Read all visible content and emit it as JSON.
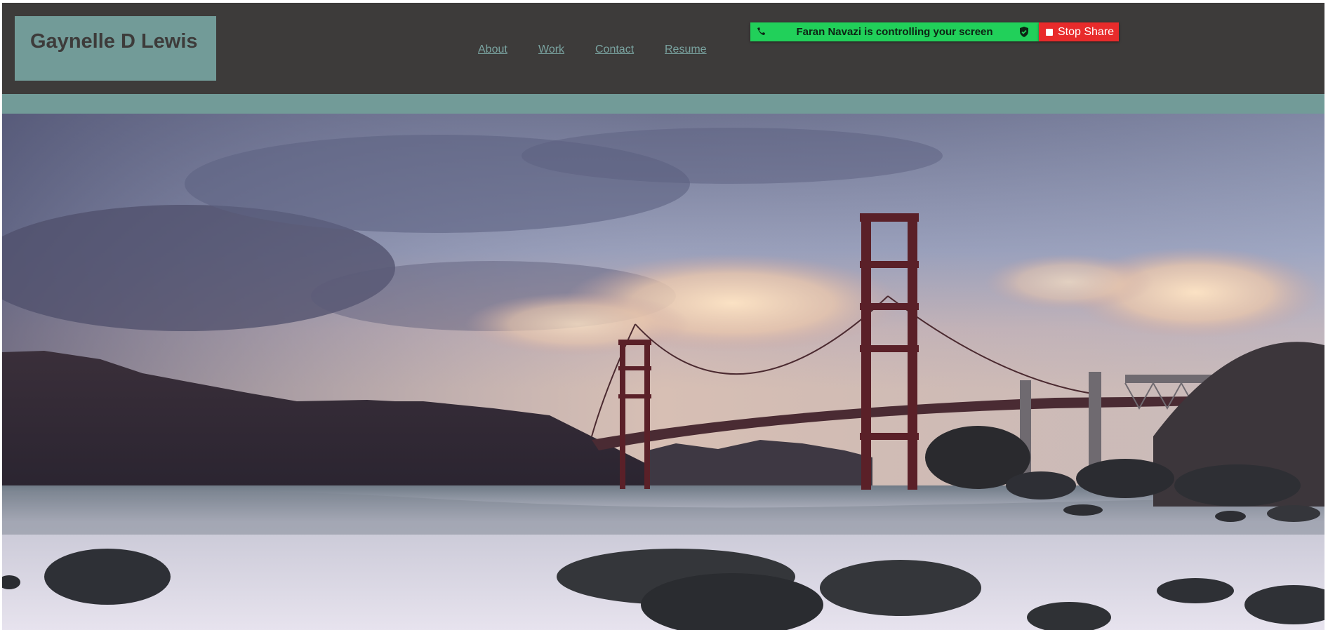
{
  "header": {
    "brand_title": "Gaynelle D Lewis",
    "nav": [
      {
        "label": "About"
      },
      {
        "label": "Work"
      },
      {
        "label": "Contact"
      },
      {
        "label": "Resume"
      }
    ]
  },
  "screen_share": {
    "message": "Faran Navazi is controlling your screen",
    "stop_label": "Stop Share",
    "bar_color": "#21d05a",
    "stop_color": "#e82b2b",
    "icons": [
      "phone-icon",
      "shield-icon",
      "stop-square-icon"
    ]
  },
  "hero": {
    "image": "golden-gate-bridge-photo"
  },
  "colors": {
    "header_bg": "#3d3b3a",
    "accent": "#729b98",
    "link": "#7aa3a0"
  }
}
